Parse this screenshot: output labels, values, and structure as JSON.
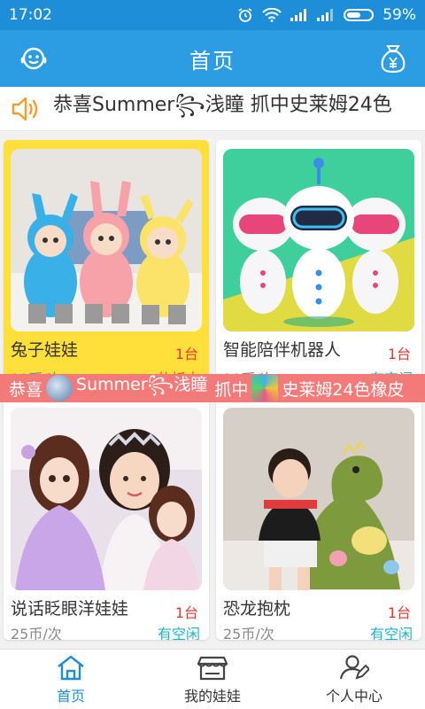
{
  "status_bar": {
    "time": "17:02",
    "battery": "59%",
    "battery_level": 0.59
  },
  "header": {
    "title": "首页",
    "left_icon": "customer-service-icon",
    "right_icon": "money-bag-icon"
  },
  "notice": {
    "icon": "speaker-icon",
    "text": "恭喜Summer꧂浅瞳 抓中史莱姆24色"
  },
  "marquee": {
    "prefix": "恭喜",
    "user": "Summer꧂浅瞳",
    "middle": "抓中",
    "prize": "史莱姆24色橡皮"
  },
  "products": [
    {
      "name": "兔子娃娃",
      "qty": "1台",
      "price": "19币/次",
      "status": "热抓中",
      "status_type": "hot"
    },
    {
      "name": "智能陪伴机器人",
      "qty": "1台",
      "price": "30币/次",
      "status": "有空闲",
      "status_type": "free"
    },
    {
      "name": "说话眨眼洋娃娃",
      "qty": "1台",
      "price": "25币/次",
      "status": "有空闲",
      "status_type": "free"
    },
    {
      "name": "恐龙抱枕",
      "qty": "1台",
      "price": "25币/次",
      "status": "有空闲",
      "status_type": "free"
    }
  ],
  "tabs": [
    {
      "label": "首页",
      "icon": "home-icon",
      "active": true
    },
    {
      "label": "我的娃娃",
      "icon": "shop-icon",
      "active": false
    },
    {
      "label": "个人中心",
      "icon": "user-edit-icon",
      "active": false
    }
  ],
  "colors": {
    "primary": "#2d9de3",
    "accent_red": "#e53935",
    "free": "#1fb3c4",
    "hot_card": "#ffe03a"
  }
}
